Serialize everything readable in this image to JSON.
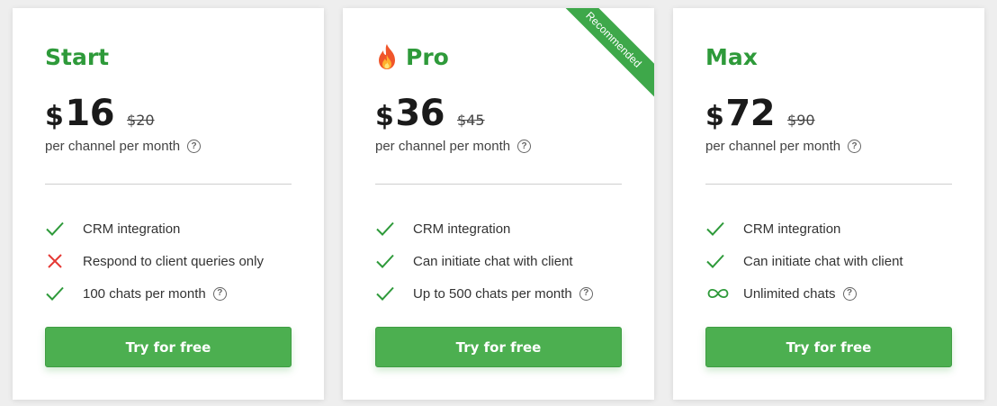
{
  "plans": [
    {
      "name": "Start",
      "currency": "$",
      "price": "16",
      "old_price": "$20",
      "period": "per channel per month",
      "features": [
        {
          "icon": "check-icon",
          "text": "CRM integration"
        },
        {
          "icon": "cross-icon",
          "text": "Respond to client queries only"
        },
        {
          "icon": "check-icon",
          "text": "100 chats per month",
          "help": true
        }
      ],
      "cta": "Try for free"
    },
    {
      "name": "Pro",
      "icon": "fire-icon",
      "ribbon": "Recommended",
      "currency": "$",
      "price": "36",
      "old_price": "$45",
      "period": "per channel per month",
      "features": [
        {
          "icon": "check-icon",
          "text": "CRM integration"
        },
        {
          "icon": "check-icon",
          "text": "Can initiate chat with client"
        },
        {
          "icon": "check-icon",
          "text": "Up to 500 chats per month",
          "help": true
        }
      ],
      "cta": "Try for free"
    },
    {
      "name": "Max",
      "currency": "$",
      "price": "72",
      "old_price": "$90",
      "period": "per channel per month",
      "features": [
        {
          "icon": "check-icon",
          "text": "CRM integration"
        },
        {
          "icon": "check-icon",
          "text": "Can initiate chat with client"
        },
        {
          "icon": "infinity-icon",
          "text": "Unlimited chats",
          "help": true
        }
      ],
      "cta": "Try for free"
    }
  ],
  "colors": {
    "accent": "#2e9a3a",
    "button": "#4caf50",
    "ribbon": "#3ea84a",
    "cross": "#e53935"
  },
  "help_glyph": "?"
}
